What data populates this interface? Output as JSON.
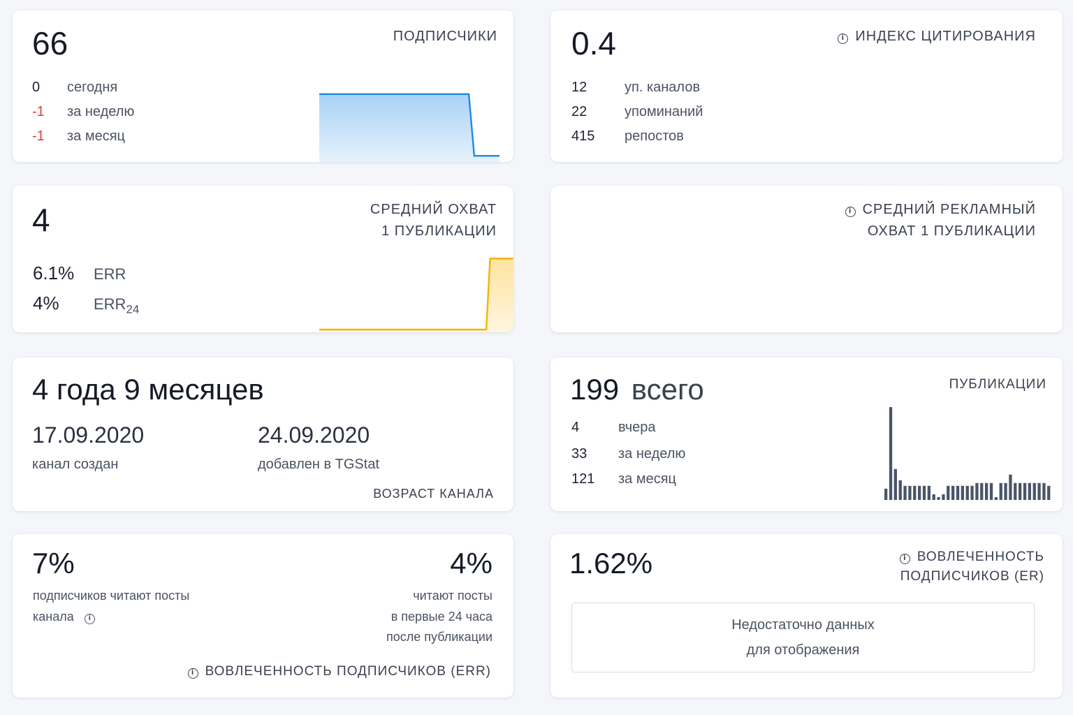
{
  "subscribers": {
    "value": "66",
    "title": "ПОДПИСЧИКИ",
    "rows": [
      {
        "value": "0",
        "label": "сегодня",
        "negative": false
      },
      {
        "value": "-1",
        "label": "за неделю",
        "negative": true
      },
      {
        "value": "-1",
        "label": "за месяц",
        "negative": true
      }
    ],
    "color": "#1e88e5"
  },
  "citation": {
    "value": "0.4",
    "title": "ИНДЕКС ЦИТИРОВАНИЯ",
    "rows": [
      {
        "value": "12",
        "label": "уп. каналов"
      },
      {
        "value": "22",
        "label": "упоминаний"
      },
      {
        "value": "415",
        "label": "репостов"
      }
    ]
  },
  "reach": {
    "value": "4",
    "title_line1": "СРЕДНИЙ ОХВАТ",
    "title_line2": "1 ПУБЛИКАЦИИ",
    "err_value": "6.1%",
    "err_label": "ERR",
    "err24_value": "4%",
    "err24_label": "ERR",
    "err24_sub": "24",
    "color": "#f4b400"
  },
  "ad_reach": {
    "title_line1": "СРЕДНИЙ РЕКЛАМНЫЙ",
    "title_line2": "ОХВАТ 1 ПУБЛИКАЦИИ"
  },
  "age": {
    "value": "4 года 9 месяцев",
    "created_date": "17.09.2020",
    "created_label": "канал создан",
    "added_date": "24.09.2020",
    "added_label": "добавлен в TGStat",
    "title": "ВОЗРАСТ КАНАЛА"
  },
  "posts": {
    "value": "199",
    "value_suffix": "всего",
    "title": "ПУБЛИКАЦИИ",
    "rows": [
      {
        "value": "4",
        "label": "вчера"
      },
      {
        "value": "33",
        "label": "за неделю"
      },
      {
        "value": "121",
        "label": "за месяц"
      }
    ],
    "color": "#4a5568"
  },
  "err": {
    "left_value": "7%",
    "left_label_1": "подписчиков читают посты",
    "left_label_2": "канала",
    "right_value": "4%",
    "right_label_1": "читают посты",
    "right_label_2": "в первые 24 часа",
    "right_label_3": "после публикации",
    "title": "ВОВЛЕЧЕННОСТЬ ПОДПИСЧИКОВ (ERR)"
  },
  "er": {
    "value": "1.62%",
    "title_line1": "ВОВЛЕЧЕННОСТЬ",
    "title_line2": "ПОДПИСЧИКОВ (ER)",
    "empty_line1": "Недостаточно данных",
    "empty_line2": "для отображения"
  },
  "chart_data": [
    {
      "type": "area",
      "name": "subscribers",
      "x": [
        0,
        0.83,
        0.86,
        1
      ],
      "values": [
        67,
        67,
        66,
        66
      ],
      "ylim": [
        65.9,
        67.1
      ]
    },
    {
      "type": "area",
      "name": "reach",
      "x": [
        0,
        0.86,
        0.88,
        1
      ],
      "values": [
        0,
        0,
        4,
        4
      ],
      "ylim": [
        0,
        4.4
      ]
    },
    {
      "type": "bar",
      "name": "posts",
      "values": [
        4,
        33,
        11,
        7,
        5,
        5,
        5,
        5,
        5,
        5,
        2,
        1,
        2,
        5,
        5,
        5,
        5,
        5,
        5,
        6,
        6,
        6,
        6,
        1,
        6,
        6,
        9,
        6,
        6,
        6,
        6,
        6,
        6,
        6,
        5
      ],
      "ylim": [
        0,
        33
      ]
    }
  ]
}
